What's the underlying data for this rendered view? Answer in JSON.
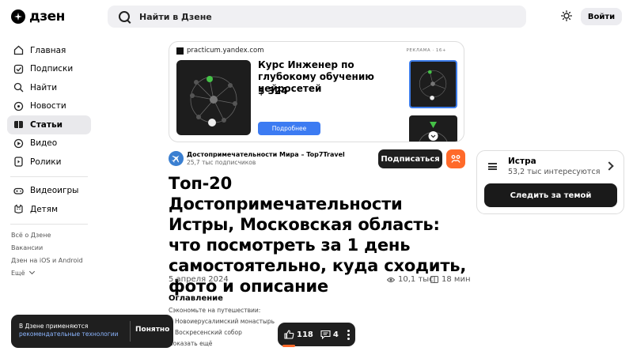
{
  "header": {
    "logo_text": "дзен",
    "search_placeholder": "Найти в Дзене",
    "login_label": "Войти"
  },
  "sidebar": {
    "items": [
      {
        "label": "Главная",
        "icon": "home-icon"
      },
      {
        "label": "Подписки",
        "icon": "subscriptions-icon"
      },
      {
        "label": "Найти",
        "icon": "search-icon"
      },
      {
        "label": "Новости",
        "icon": "news-icon"
      },
      {
        "label": "Статьи",
        "icon": "articles-icon",
        "active": true
      },
      {
        "label": "Видео",
        "icon": "video-icon"
      },
      {
        "label": "Ролики",
        "icon": "shorts-icon"
      }
    ],
    "items2": [
      {
        "label": "Видеоигры",
        "icon": "gamepad-icon"
      },
      {
        "label": "Детям",
        "icon": "kids-icon"
      }
    ],
    "links": [
      "Всё о Дзене",
      "Вакансии",
      "Дзен на iOS и Android",
      "Ещё"
    ]
  },
  "ad": {
    "domain": "practicum.yandex.com",
    "label": "РЕКЛАМА · 16+",
    "title": "Курс Инженер по глубокому обучению нейросетей",
    "price": "$ 324",
    "button": "Подробнее"
  },
  "channel": {
    "name": "Достопримечательности Мира – Top7Travel",
    "subscribers": "25,7 тыс подписчиков",
    "subscribe_label": "Подписаться"
  },
  "article": {
    "title": "Топ-20 Достопримечательности Истры, Московская область: что посмотреть за 1 день самостоятельно, куда сходить, фото и описание",
    "date": "5 апреля 2024",
    "views": "10,1 тыс",
    "read_time": "18 мин",
    "toc_title": "Оглавление",
    "toc_sub": "Сэкономьте на путешествии:",
    "toc_items": [
      "Новоиерусалимский монастырь",
      "Воскресенский собор"
    ],
    "toc_more": "Показать ещё"
  },
  "topic": {
    "name": "Истра",
    "count": "53,2 тыс интересуются",
    "button": "Следить за темой"
  },
  "cookie": {
    "text": "В Дзене применяются",
    "link": "рекомендательные технологии",
    "button": "Понятно"
  },
  "actions": {
    "likes": "118",
    "comments": "4"
  },
  "colors": {
    "accent": "#ff6a2a",
    "button_blue": "#3c7bf2",
    "dark": "#1f1f1f"
  }
}
